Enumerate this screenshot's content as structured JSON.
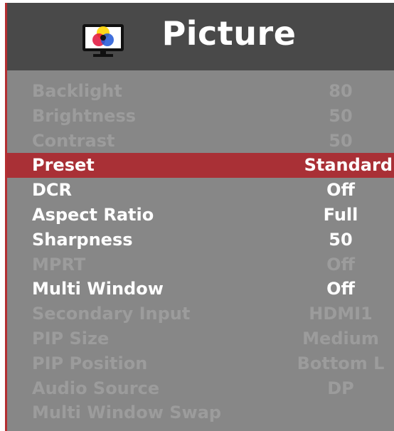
{
  "header": {
    "title": "Picture",
    "icon": "monitor-color-icon"
  },
  "colors": {
    "header_bg": "#494949",
    "panel_bg": "#878787",
    "selected_bg": "#a93036",
    "accent_border": "#b42e31",
    "enabled_text": "#ffffff",
    "disabled_text": "#9c9c9c"
  },
  "menu": {
    "items": [
      {
        "label": "Backlight",
        "value": "80",
        "state": "disabled"
      },
      {
        "label": "Brightness",
        "value": "50",
        "state": "disabled"
      },
      {
        "label": "Contrast",
        "value": "50",
        "state": "disabled"
      },
      {
        "label": "Preset",
        "value": "Standard",
        "state": "selected"
      },
      {
        "label": "DCR",
        "value": "Off",
        "state": "enabled"
      },
      {
        "label": "Aspect Ratio",
        "value": "Full",
        "state": "enabled"
      },
      {
        "label": "Sharpness",
        "value": "50",
        "state": "enabled"
      },
      {
        "label": "MPRT",
        "value": "Off",
        "state": "disabled"
      },
      {
        "label": "Multi Window",
        "value": "Off",
        "state": "enabled"
      },
      {
        "label": "Secondary Input",
        "value": "HDMI1",
        "state": "disabled"
      },
      {
        "label": "PIP Size",
        "value": "Medium",
        "state": "disabled"
      },
      {
        "label": "PIP Position",
        "value": "Bottom L",
        "state": "disabled"
      },
      {
        "label": "Audio Source",
        "value": "DP",
        "state": "disabled"
      },
      {
        "label": "Multi Window Swap",
        "value": "",
        "state": "disabled"
      }
    ]
  }
}
